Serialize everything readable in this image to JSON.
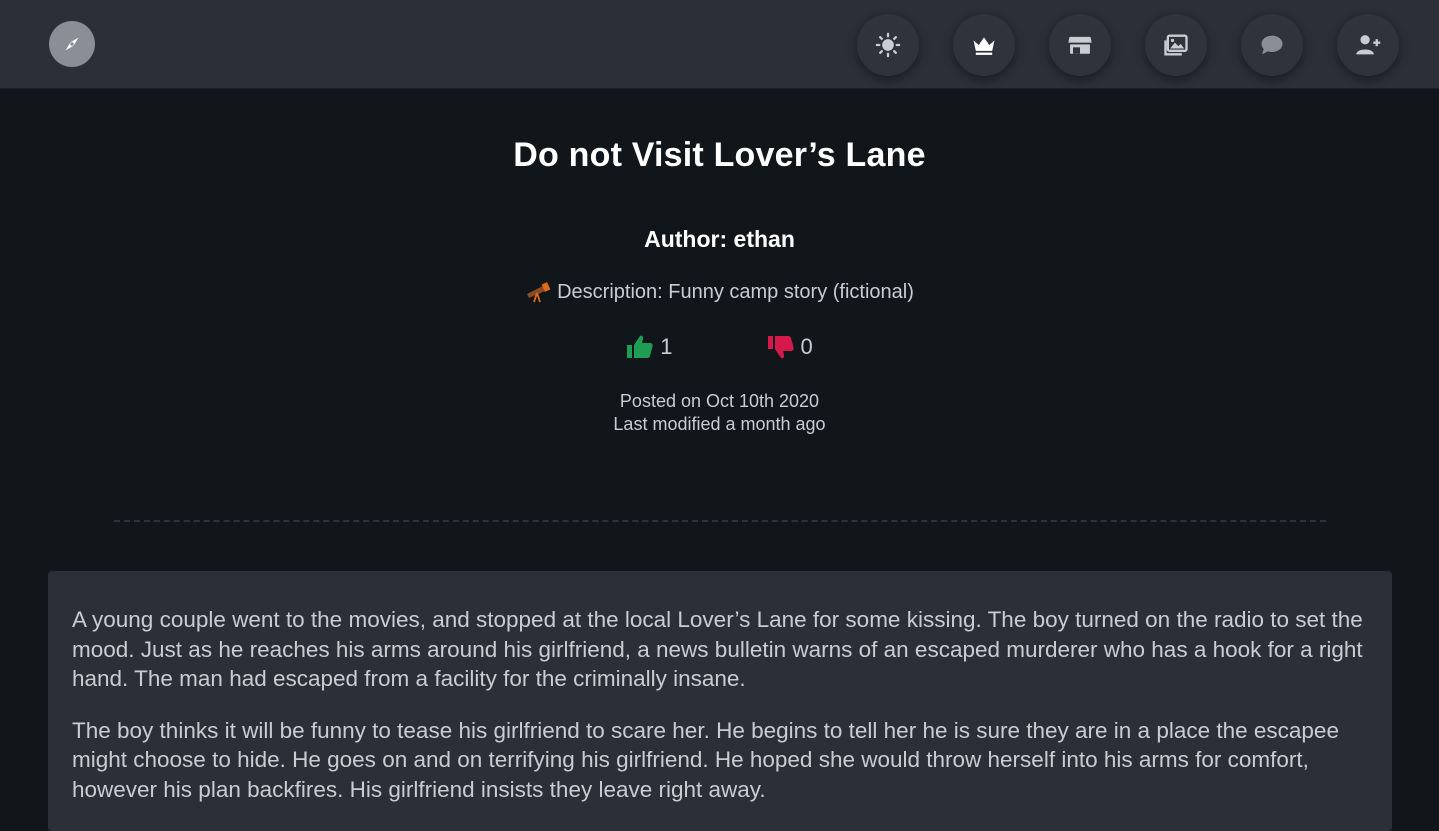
{
  "nav": {
    "icons": [
      "theme-toggle-icon",
      "crown-icon",
      "store-icon",
      "gallery-icon",
      "chat-icon",
      "add-user-icon"
    ]
  },
  "post": {
    "title": "Do not Visit Lover’s Lane",
    "author": "Author: ethan",
    "description": "Description: Funny camp story (fictional)",
    "likes": "1",
    "dislikes": "0",
    "posted": "Posted on Oct 10th 2020",
    "modified": "Last modified a month ago"
  },
  "story": {
    "paragraphs": [
      "A young couple went to the movies, and stopped at the local Lover’s Lane for some kissing. The boy turned on the radio to set the mood. Just as he reaches his arms around his girlfriend, a news bulletin warns of an escaped murderer who has a hook for a right hand. The man had escaped from a facility for the criminally insane.",
      "The boy thinks it will be funny to tease his girlfriend to scare her. He begins to tell her he is sure they are in a place the escapee might choose to hide. He goes on and on terrifying his girlfriend. He hoped she would throw herself into his arms for comfort, however his plan backfires. His girlfriend insists they leave right away."
    ]
  },
  "colors": {
    "like": "#1f9d55",
    "dislike": "#d6194b",
    "telescope": "#e06a1b"
  }
}
